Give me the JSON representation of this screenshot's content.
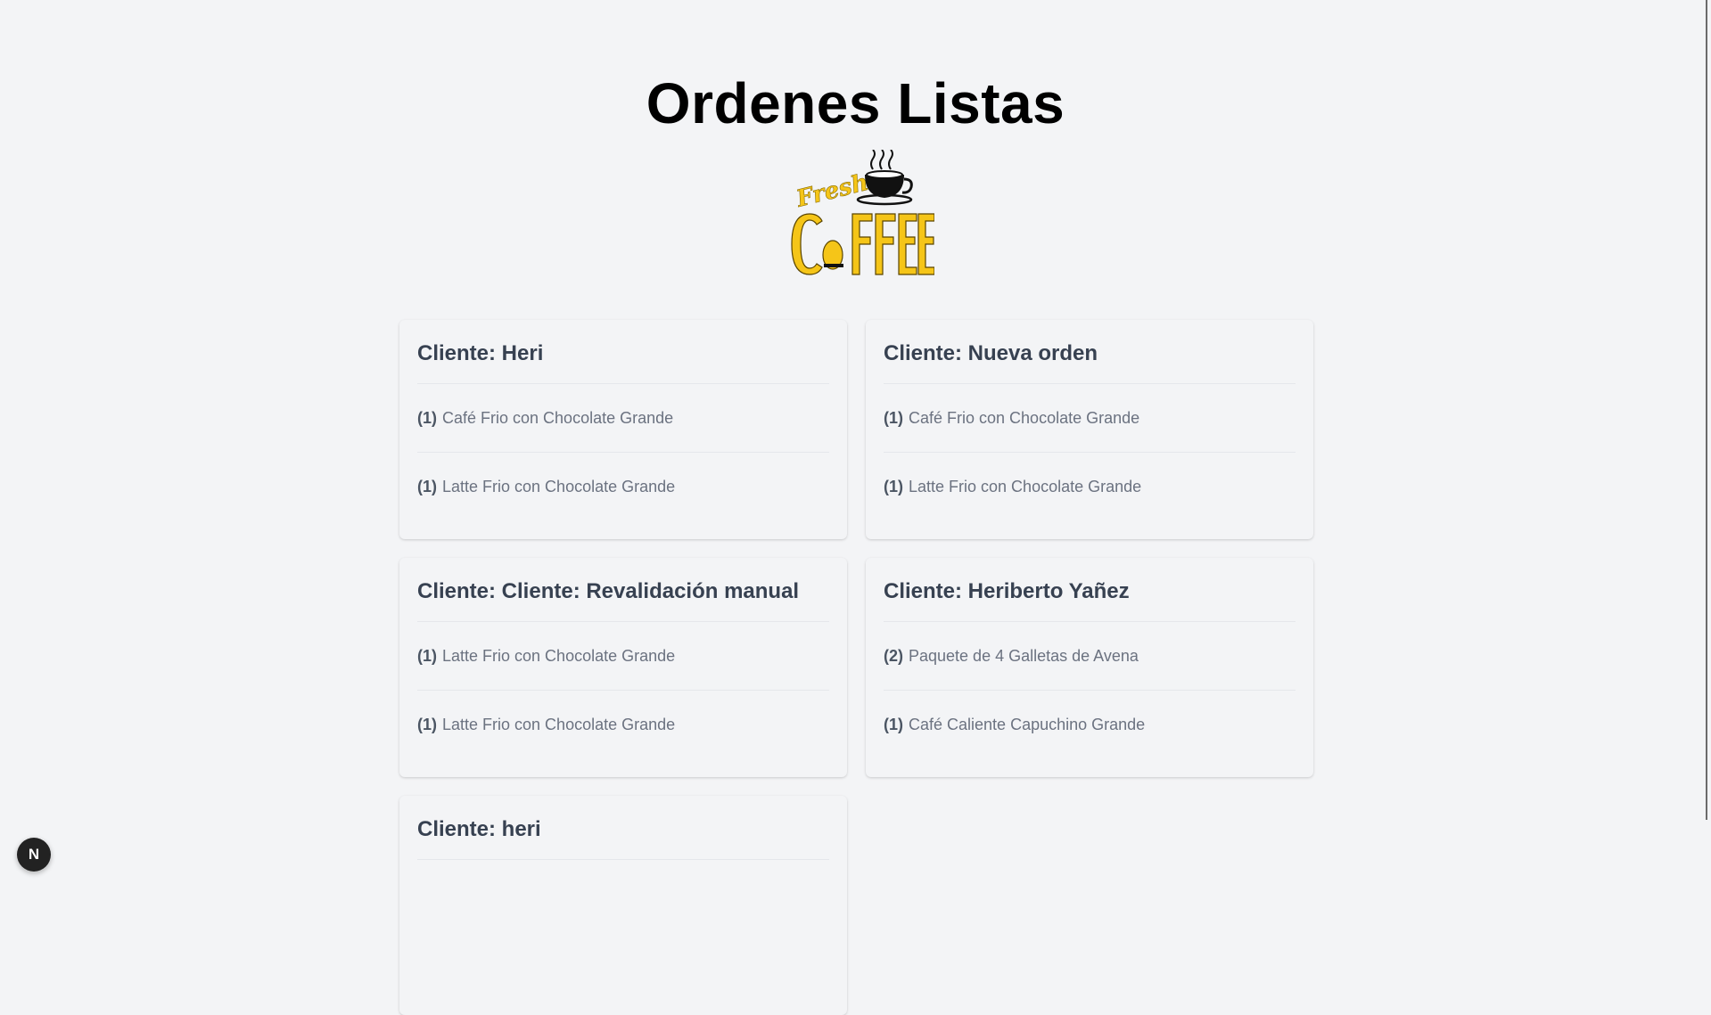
{
  "page": {
    "title": "Ordenes Listas",
    "logo": {
      "small_text": "Fresh",
      "big_text": "CoFFEE",
      "accent_color": "#f5c518"
    }
  },
  "orders": [
    {
      "client_label": "Cliente: Heri",
      "items": [
        {
          "qty": "(1)",
          "name": "Café Frio con Chocolate Grande"
        },
        {
          "qty": "(1)",
          "name": "Latte Frio con Chocolate Grande"
        }
      ]
    },
    {
      "client_label": "Cliente: Nueva orden",
      "items": [
        {
          "qty": "(1)",
          "name": "Café Frio con Chocolate Grande"
        },
        {
          "qty": "(1)",
          "name": "Latte Frio con Chocolate Grande"
        }
      ]
    },
    {
      "client_label": "Cliente: Cliente: Revalidación manual",
      "items": [
        {
          "qty": "(1)",
          "name": "Latte Frio con Chocolate Grande"
        },
        {
          "qty": "(1)",
          "name": "Latte Frio con Chocolate Grande"
        }
      ]
    },
    {
      "client_label": "Cliente: Heriberto Yañez",
      "items": [
        {
          "qty": "(2)",
          "name": "Paquete de 4 Galletas de Avena"
        },
        {
          "qty": "(1)",
          "name": "Café Caliente Capuchino Grande"
        }
      ]
    },
    {
      "client_label": "Cliente: heri",
      "items": []
    }
  ],
  "dev_badge": {
    "label": "N",
    "icon": "nextjs-icon"
  }
}
